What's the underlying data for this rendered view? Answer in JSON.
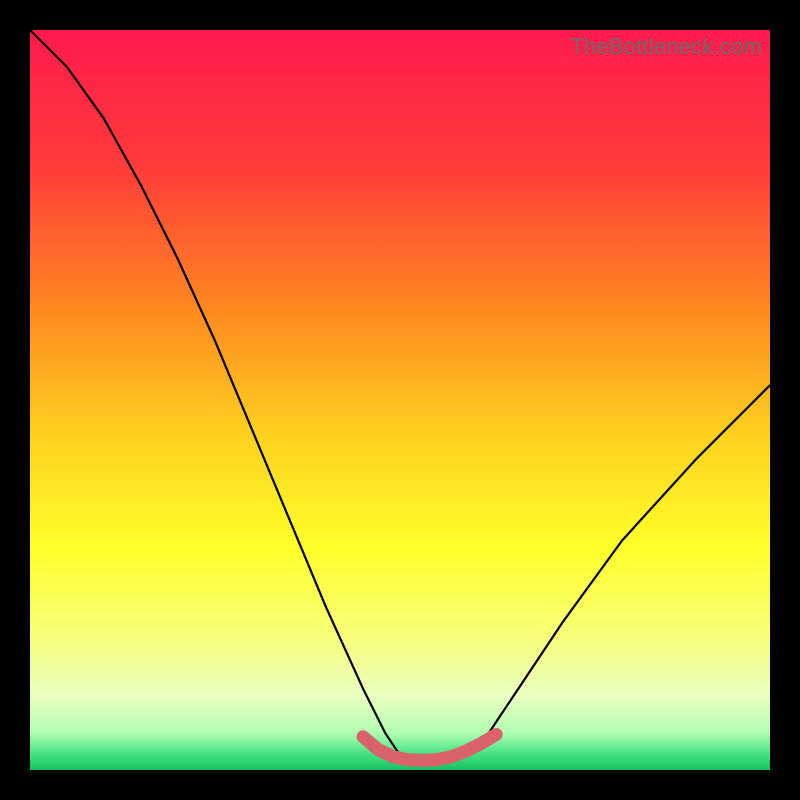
{
  "watermark": "TheBottleneck.com",
  "chart_data": {
    "type": "line",
    "title": "",
    "xlabel": "",
    "ylabel": "",
    "xlim": [
      0,
      100
    ],
    "ylim": [
      0,
      100
    ],
    "gradient_stops": [
      {
        "offset": 0,
        "color": "#ff1a4d"
      },
      {
        "offset": 18,
        "color": "#ff3a3a"
      },
      {
        "offset": 38,
        "color": "#ff8a1f"
      },
      {
        "offset": 55,
        "color": "#ffd21f"
      },
      {
        "offset": 70,
        "color": "#ffff2a"
      },
      {
        "offset": 82,
        "color": "#f7ff7a"
      },
      {
        "offset": 90,
        "color": "#eaffc0"
      },
      {
        "offset": 95,
        "color": "#b0ffb0"
      },
      {
        "offset": 98,
        "color": "#40e080"
      },
      {
        "offset": 100,
        "color": "#18c060"
      }
    ],
    "series": [
      {
        "name": "bottleneck-curve",
        "color": "#000000",
        "width": 2.2,
        "x": [
          0,
          5,
          10,
          15,
          20,
          25,
          30,
          35,
          40,
          45,
          48,
          50,
          52,
          55,
          58,
          62,
          66,
          72,
          80,
          90,
          100
        ],
        "y": [
          100,
          95,
          88,
          79,
          69,
          58,
          46,
          34,
          22,
          11,
          5,
          2,
          1,
          1,
          2,
          5,
          11,
          20,
          31,
          42,
          52
        ]
      },
      {
        "name": "optimal-band",
        "color": "#d9626b",
        "width": 13,
        "linecap": "round",
        "x": [
          45,
          47,
          49,
          51,
          53,
          55,
          57,
          59,
          61,
          63
        ],
        "y": [
          4.5,
          2.8,
          1.8,
          1.4,
          1.3,
          1.4,
          1.8,
          2.6,
          3.6,
          4.8
        ]
      }
    ]
  }
}
